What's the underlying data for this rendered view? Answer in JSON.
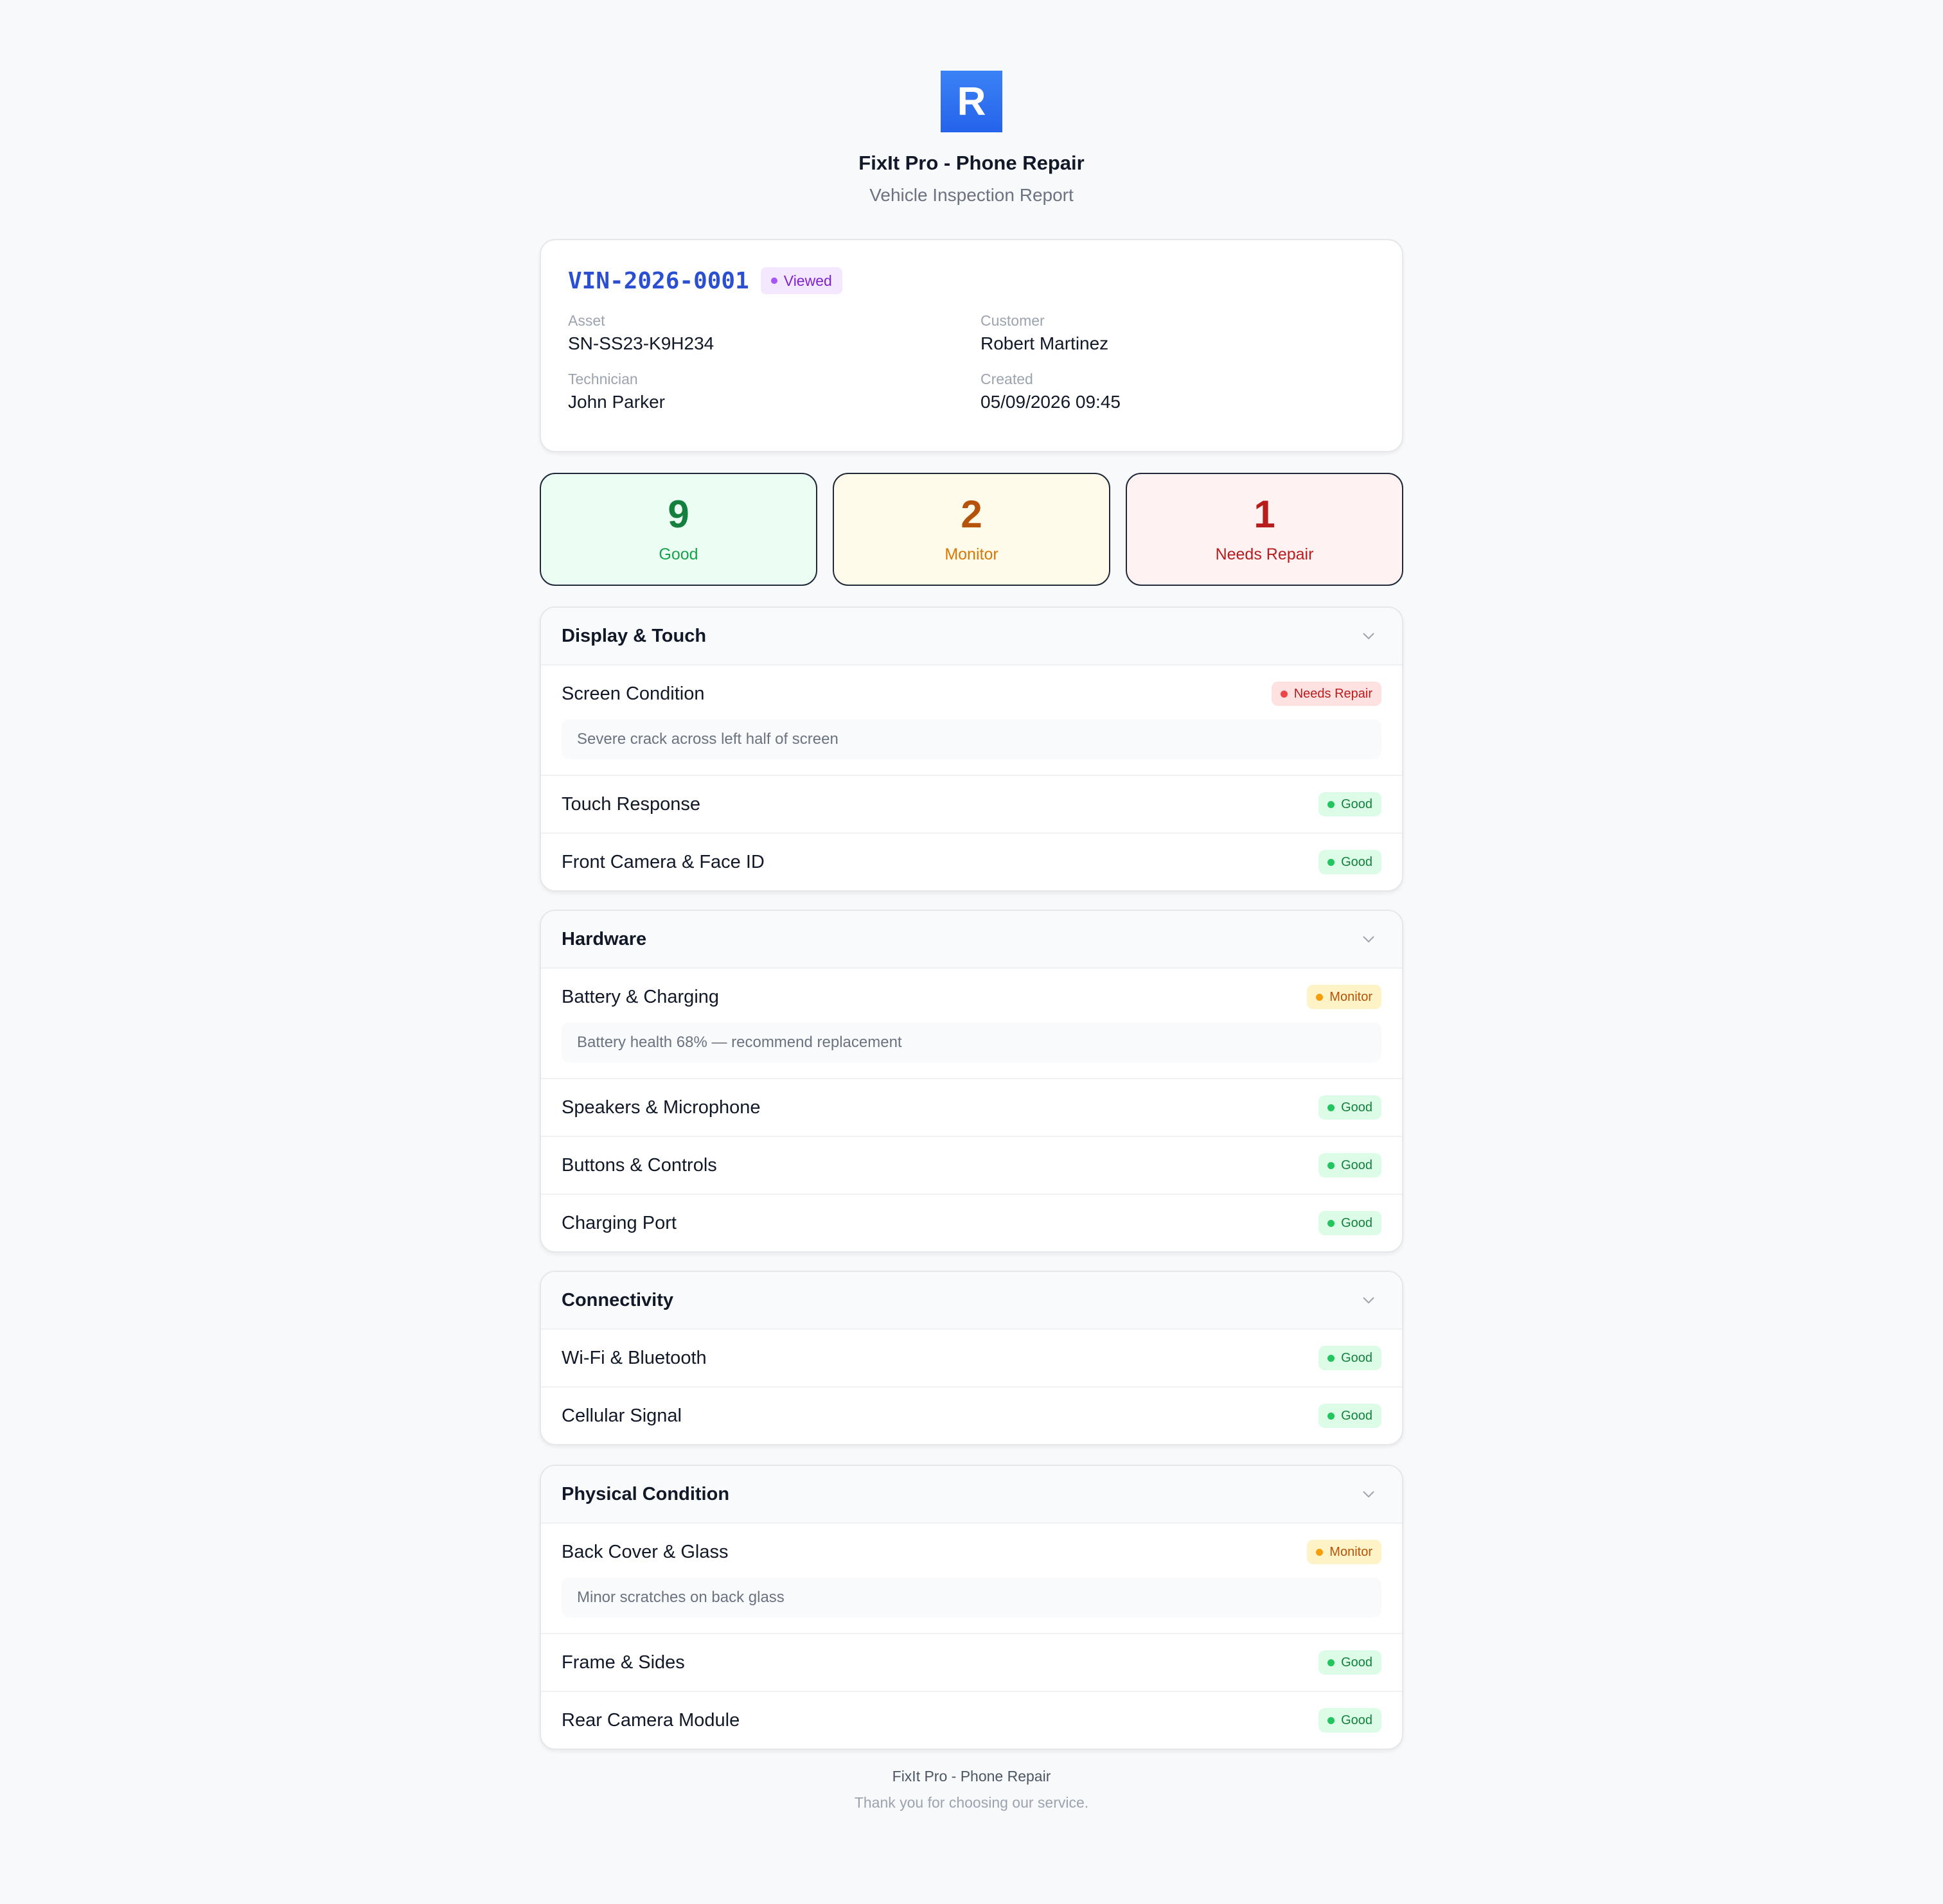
{
  "header": {
    "logo_letter": "R",
    "business_name": "FixIt Pro - Phone Repair",
    "report_title": "Vehicle Inspection Report"
  },
  "info": {
    "vin": "VIN-2026-0001",
    "status": "Viewed",
    "asset_label": "Asset",
    "asset_value": "SN-SS23-K9H234",
    "customer_label": "Customer",
    "customer_value": "Robert Martinez",
    "technician_label": "Technician",
    "technician_value": "John Parker",
    "created_label": "Created",
    "created_value": "05/09/2026 09:45"
  },
  "summary": {
    "good_count": "9",
    "good_label": "Good",
    "monitor_count": "2",
    "monitor_label": "Monitor",
    "repair_count": "1",
    "repair_label": "Needs Repair"
  },
  "sections": [
    {
      "title": "Display & Touch",
      "items": [
        {
          "name": "Screen Condition",
          "status": "Needs Repair",
          "note": "Severe crack across left half of screen"
        },
        {
          "name": "Touch Response",
          "status": "Good"
        },
        {
          "name": "Front Camera & Face ID",
          "status": "Good"
        }
      ]
    },
    {
      "title": "Hardware",
      "items": [
        {
          "name": "Battery & Charging",
          "status": "Monitor",
          "note": "Battery health 68% — recommend replacement"
        },
        {
          "name": "Speakers & Microphone",
          "status": "Good"
        },
        {
          "name": "Buttons & Controls",
          "status": "Good"
        },
        {
          "name": "Charging Port",
          "status": "Good"
        }
      ]
    },
    {
      "title": "Connectivity",
      "items": [
        {
          "name": "Wi-Fi & Bluetooth",
          "status": "Good"
        },
        {
          "name": "Cellular Signal",
          "status": "Good"
        }
      ]
    },
    {
      "title": "Physical Condition",
      "items": [
        {
          "name": "Back Cover & Glass",
          "status": "Monitor",
          "note": "Minor scratches on back glass"
        },
        {
          "name": "Frame & Sides",
          "status": "Good"
        },
        {
          "name": "Rear Camera Module",
          "status": "Good"
        }
      ]
    }
  ],
  "footer": {
    "line1": "FixIt Pro - Phone Repair",
    "line2": "Thank you for choosing our service."
  },
  "colors": {
    "accent": "#2563eb",
    "good": "#16a34a",
    "monitor": "#d97706",
    "needs_repair": "#b91c1c",
    "viewed": "#7e22ce"
  },
  "icons": {
    "section_toggle": "chevron-down-icon",
    "status_dot": "status-dot-icon"
  }
}
